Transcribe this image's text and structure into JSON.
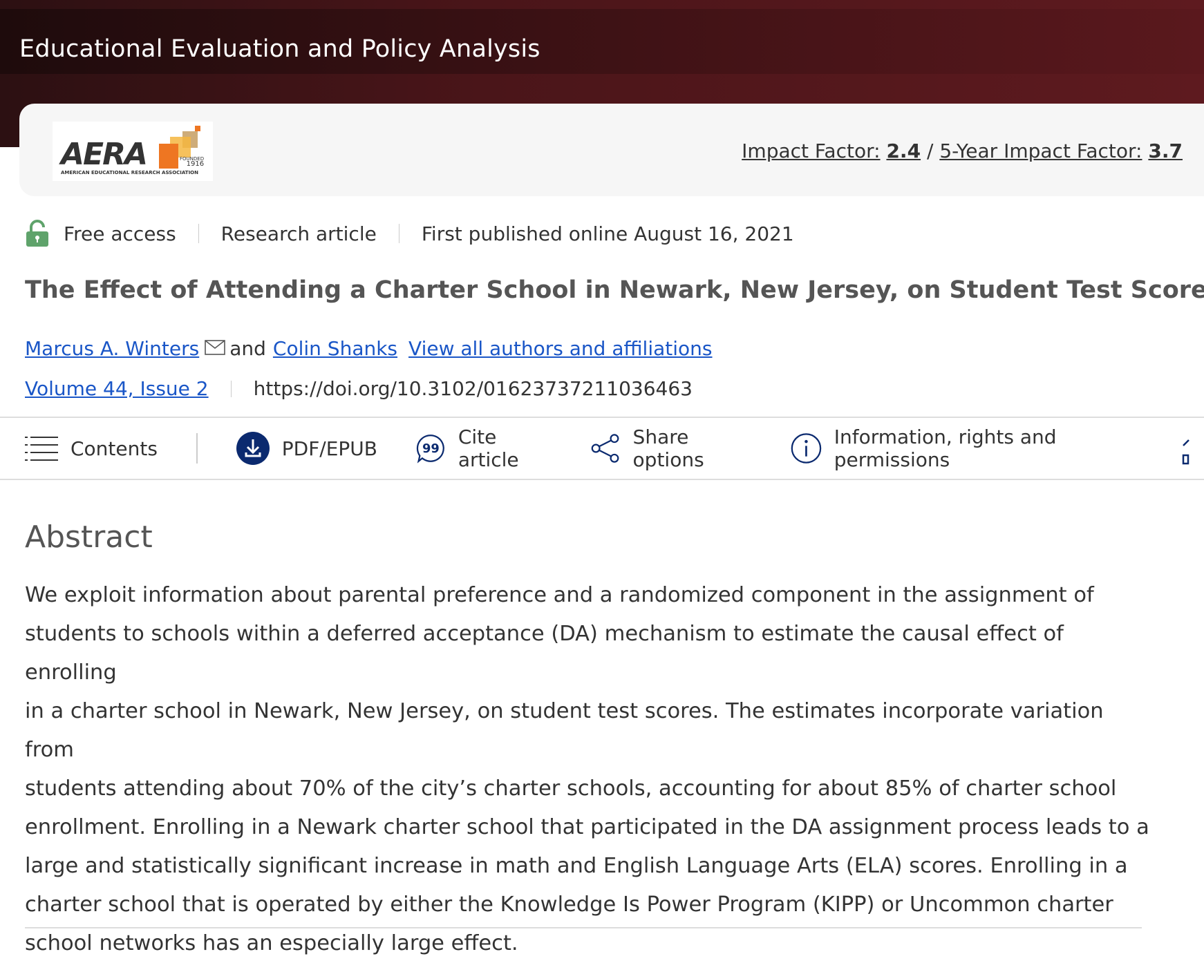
{
  "journal": {
    "title": "Educational Evaluation and Policy Analysis"
  },
  "logo": {
    "wordmark": "AERA",
    "founded_label": "FOUNDED",
    "founded_year": "1916",
    "association": "AMERICAN EDUCATIONAL RESEARCH ASSOCIATION"
  },
  "impact": {
    "label": "Impact Factor:",
    "value": "2.4",
    "separator": "/",
    "five_year_label": "5-Year Impact Factor:",
    "five_year_value": "3.7"
  },
  "meta": {
    "access": "Free access",
    "type": "Research article",
    "published": "First published online August 16, 2021"
  },
  "article": {
    "title": "The Effect of Attending a Charter School in Newark, New Jersey, on Student Test Scores",
    "author1": "Marcus A. Winters",
    "and": "and",
    "author2": "Colin Shanks",
    "all_authors_link": "View all authors and affiliations",
    "volume": "Volume 44, Issue 2",
    "doi": "https://doi.org/10.3102/01623737211036463"
  },
  "toolbar": {
    "contents": "Contents",
    "pdf": "PDF/EPUB",
    "cite": "Cite article",
    "share": "Share options",
    "info": "Information, rights and permissions"
  },
  "abstract": {
    "heading": "Abstract",
    "lines": [
      "We exploit information about parental preference and a randomized component in the assignment of",
      "students to schools within a deferred acceptance (DA) mechanism to estimate the causal effect of enrolling",
      "in a charter school in Newark, New Jersey, on student test scores. The estimates incorporate variation from",
      "students attending about 70% of the city’s charter schools, accounting for about 85% of charter school",
      "enrollment. Enrolling in a Newark charter school that participated in the DA assignment process leads to a",
      "large and statistically significant increase in math and English Language Arts (ELA) scores. Enrolling in a",
      "charter school that is operated by either the Knowledge Is Power Program (KIPP) or Uncommon charter",
      "school networks has an especially large effect."
    ]
  },
  "colors": {
    "header_dark": "#1e0b0c",
    "header_red": "#5e1a1f",
    "link": "#1a56c7",
    "lock_green": "#5fa36b",
    "pdf_navy": "#0b2a6f"
  }
}
